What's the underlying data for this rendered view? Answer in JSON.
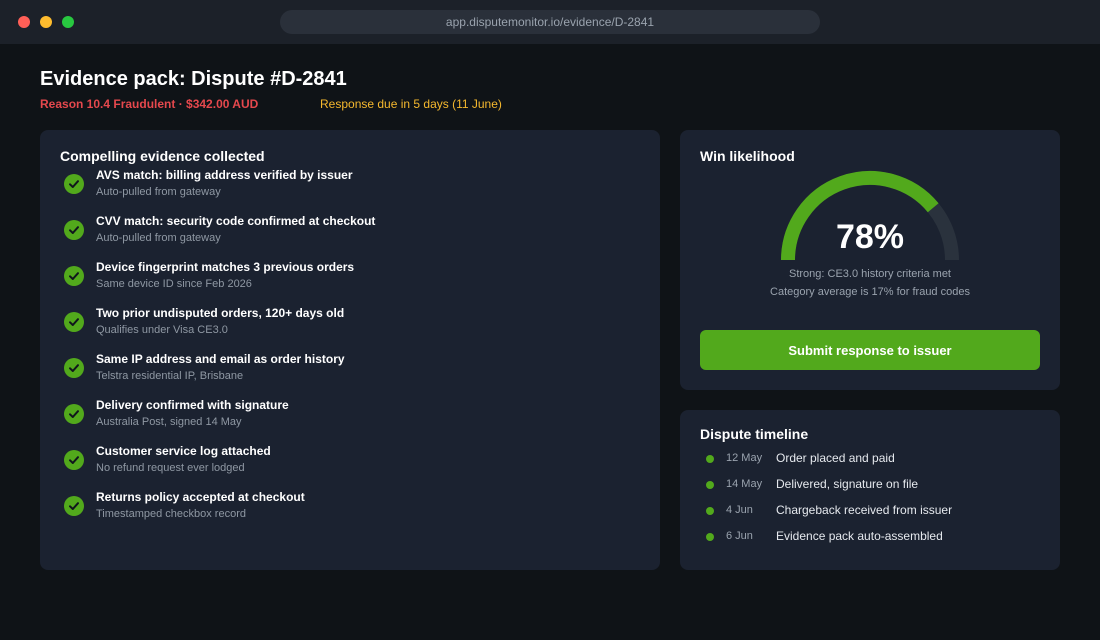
{
  "browser": {
    "url": "app.disputemonitor.io/evidence/D-2841"
  },
  "header": {
    "title": "Evidence pack: Dispute #D-2841",
    "reason": "Reason 10.4 Fraudulent · $342.00 AUD",
    "due": "Response due in 5 days (11 June)"
  },
  "evidence": {
    "heading": "Compelling evidence collected",
    "items": [
      {
        "title": "AVS match: billing address verified by issuer",
        "sub": "Auto-pulled from gateway"
      },
      {
        "title": "CVV match: security code confirmed at checkout",
        "sub": "Auto-pulled from gateway"
      },
      {
        "title": "Device fingerprint matches 3 previous orders",
        "sub": "Same device ID since Feb 2026"
      },
      {
        "title": "Two prior undisputed orders, 120+ days old",
        "sub": "Qualifies under Visa CE3.0"
      },
      {
        "title": "Same IP address and email as order history",
        "sub": "Telstra residential IP, Brisbane"
      },
      {
        "title": "Delivery confirmed with signature",
        "sub": "Australia Post, signed 14 May"
      },
      {
        "title": "Customer service log attached",
        "sub": "No refund request ever lodged"
      },
      {
        "title": "Returns policy accepted at checkout",
        "sub": "Timestamped checkbox record"
      }
    ]
  },
  "win": {
    "heading": "Win likelihood",
    "value_label": "78%",
    "value": 0.78,
    "note1": "Strong: CE3.0 history criteria met",
    "note2": "Category average is 17% for fraud codes",
    "submit_label": "Submit response to issuer"
  },
  "timeline": {
    "heading": "Dispute timeline",
    "items": [
      {
        "date": "12 May",
        "text": "Order placed and paid"
      },
      {
        "date": "14 May",
        "text": "Delivered, signature on file"
      },
      {
        "date": "4 Jun",
        "text": "Chargeback received from issuer"
      },
      {
        "date": "6 Jun",
        "text": "Evidence pack auto-assembled"
      }
    ]
  },
  "colors": {
    "accent": "#52a91c",
    "danger": "#e5484d",
    "warning": "#f5b82e",
    "card": "#1b2230",
    "background": "#0f1317"
  }
}
